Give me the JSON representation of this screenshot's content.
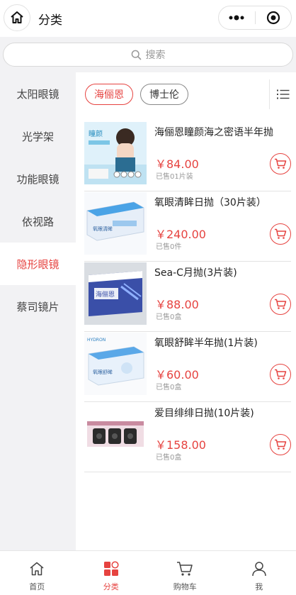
{
  "header": {
    "title": "分类",
    "home_icon": "home-icon",
    "more_icon": "more-dots-icon",
    "close_icon": "target-close-icon"
  },
  "search": {
    "placeholder": "搜索",
    "icon": "search-icon"
  },
  "sidebar": {
    "items": [
      {
        "label": "太阳眼镜"
      },
      {
        "label": "光学架"
      },
      {
        "label": "功能眼镜"
      },
      {
        "label": "依视路"
      },
      {
        "label": "隐形眼镜",
        "active": true
      },
      {
        "label": "蔡司镜片"
      }
    ]
  },
  "brands": {
    "items": [
      {
        "label": "海俪恩",
        "active": true
      },
      {
        "label": "博士伦"
      }
    ],
    "toggle_icon": "list-view-icon"
  },
  "products": [
    {
      "name": "海俪恩瞳颜海之密语半年抛",
      "price": "￥84.00",
      "sold": "已售01片装"
    },
    {
      "name": "氧眼清眸日抛（30片装）",
      "price": "￥240.00",
      "sold": "已售0件"
    },
    {
      "name": "Sea-C月抛(3片装)",
      "price": "￥88.00",
      "sold": "已售0盒"
    },
    {
      "name": "氧眼舒眸半年抛(1片装)",
      "price": "￥60.00",
      "sold": "已售0盒"
    },
    {
      "name": "爱目绯绯日抛(10片装)",
      "price": "￥158.00",
      "sold": "已售0盒"
    }
  ],
  "tabbar": {
    "items": [
      {
        "label": "首页",
        "icon": "home-icon"
      },
      {
        "label": "分类",
        "icon": "category-icon",
        "active": true
      },
      {
        "label": "购物车",
        "icon": "cart-icon"
      },
      {
        "label": "我",
        "icon": "user-icon"
      }
    ]
  },
  "colors": {
    "accent": "#e64340",
    "sidebar_bg": "#f2f2f4"
  }
}
